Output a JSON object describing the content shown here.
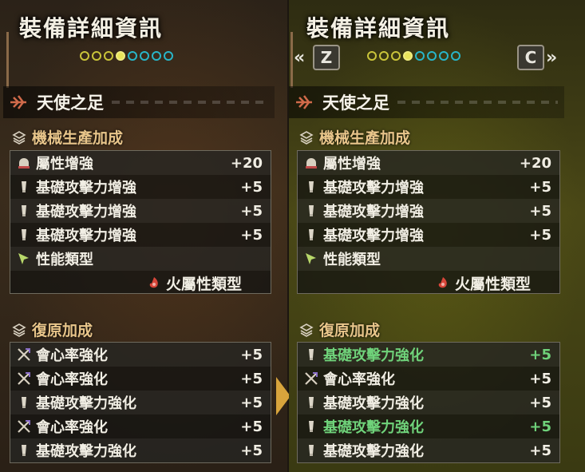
{
  "colors": {
    "title_text": "#f4f0e4",
    "section_header": "#e8c58a",
    "improved_stat": "#6fd27a",
    "dot_yellow": "#c9c43a",
    "dot_cyan": "#28b5c8",
    "fire_icon": "#d8463a"
  },
  "left": {
    "title": "裝備詳細資訊",
    "pager": {
      "total": 8,
      "current": 4
    },
    "equipment_name": "天使之足",
    "factory_section": {
      "header": "機械生產加成",
      "rows": [
        {
          "icon": "element-boost-icon",
          "label": "屬性增強",
          "value": "+20"
        },
        {
          "icon": "attack-boost-icon",
          "label": "基礎攻擊力增強",
          "value": "+5"
        },
        {
          "icon": "attack-boost-icon",
          "label": "基礎攻擊力增強",
          "value": "+5"
        },
        {
          "icon": "attack-boost-icon",
          "label": "基礎攻擊力增強",
          "value": "+5"
        },
        {
          "icon": "type-cursor-icon",
          "label": "性能類型",
          "value": ""
        }
      ],
      "type_value": "火屬性類型"
    },
    "restore_section": {
      "header": "復原加成",
      "rows": [
        {
          "icon": "affinity-icon",
          "label": "會心率強化",
          "value": "+5"
        },
        {
          "icon": "affinity-icon",
          "label": "會心率強化",
          "value": "+5"
        },
        {
          "icon": "attack-boost-icon",
          "label": "基礎攻擊力強化",
          "value": "+5"
        },
        {
          "icon": "affinity-icon",
          "label": "會心率強化",
          "value": "+5"
        },
        {
          "icon": "attack-boost-icon",
          "label": "基礎攻擊力強化",
          "value": "+5"
        }
      ]
    }
  },
  "right": {
    "title": "裝備詳細資訊",
    "pager": {
      "total": 8,
      "current": 4
    },
    "prev_key": "Z",
    "next_key": "C",
    "prev_arrow": "«",
    "next_arrow": "»",
    "equipment_name": "天使之足",
    "factory_section": {
      "header": "機械生產加成",
      "rows": [
        {
          "icon": "element-boost-icon",
          "label": "屬性增強",
          "value": "+20"
        },
        {
          "icon": "attack-boost-icon",
          "label": "基礎攻擊力增強",
          "value": "+5"
        },
        {
          "icon": "attack-boost-icon",
          "label": "基礎攻擊力增強",
          "value": "+5"
        },
        {
          "icon": "attack-boost-icon",
          "label": "基礎攻擊力增強",
          "value": "+5"
        },
        {
          "icon": "type-cursor-icon",
          "label": "性能類型",
          "value": ""
        }
      ],
      "type_value": "火屬性類型"
    },
    "restore_section": {
      "header": "復原加成",
      "rows": [
        {
          "icon": "attack-boost-icon",
          "label": "基礎攻擊力強化",
          "value": "+5",
          "changed": true
        },
        {
          "icon": "affinity-icon",
          "label": "會心率強化",
          "value": "+5"
        },
        {
          "icon": "attack-boost-icon",
          "label": "基礎攻擊力強化",
          "value": "+5"
        },
        {
          "icon": "attack-boost-icon",
          "label": "基礎攻擊力強化",
          "value": "+5",
          "changed": true
        },
        {
          "icon": "attack-boost-icon",
          "label": "基礎攻擊力強化",
          "value": "+5"
        }
      ]
    }
  }
}
